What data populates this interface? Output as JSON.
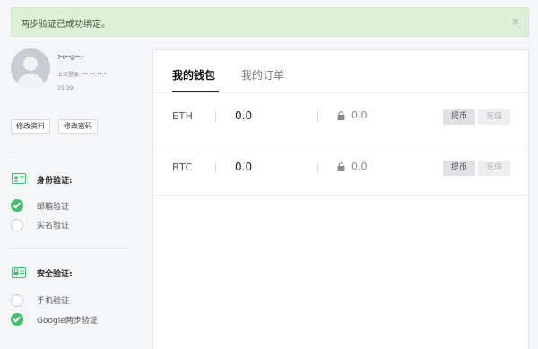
{
  "alert": {
    "message": "两步验证已成功绑定。",
    "close": "×"
  },
  "profile": {
    "username": "7*0**@**.*",
    "last_login_label": "上次登录:",
    "last_login_value": "**.**.**.*",
    "last_login_time": "15:39"
  },
  "profile_buttons": {
    "edit_profile": "修改资料",
    "change_password": "修改密码"
  },
  "identity": {
    "title": "身份验证:",
    "items": [
      {
        "label": "邮箱验证",
        "checked": true
      },
      {
        "label": "实名验证",
        "checked": false
      }
    ]
  },
  "security": {
    "title": "安全验证:",
    "items": [
      {
        "label": "手机验证",
        "checked": false
      },
      {
        "label": "Google两步验证",
        "checked": true
      }
    ]
  },
  "tabs": [
    {
      "label": "我的钱包"
    },
    {
      "label": "我的订单"
    }
  ],
  "wallet": [
    {
      "coin": "ETH",
      "balance": "0.0",
      "frozen": "0.0",
      "withdraw": "提币",
      "deposit": "充值"
    },
    {
      "coin": "BTC",
      "balance": "0.0",
      "frozen": "0.0",
      "withdraw": "提币",
      "deposit": "充值"
    }
  ],
  "colors": {
    "success": "#3fbf6b",
    "alert_bg": "#dff0d8",
    "tab_active": "#1d2233"
  }
}
